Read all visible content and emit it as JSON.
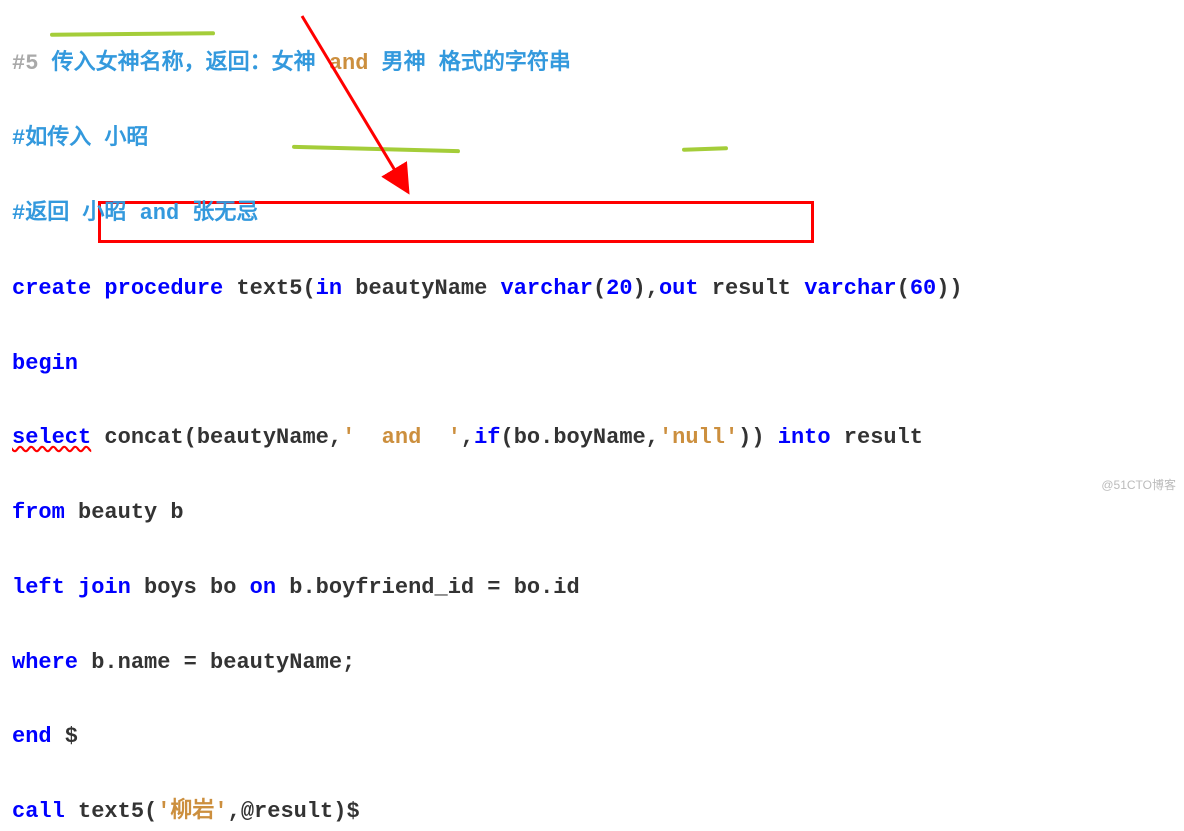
{
  "lines": {
    "l1_hash": "#5",
    "l1_part1": " 传入女神名称，返回：女神 ",
    "l1_and": "and",
    "l1_part2": " 男神 格式的字符串",
    "l2": "#如传入 小昭",
    "l3": "#返回 小昭 and 张无忌",
    "l4_create": "create",
    "l4_procedure": " procedure",
    "l4_text5": " text5",
    "l4_paren_open": "(",
    "l4_in": "in",
    "l4_beautyName": " beautyName ",
    "l4_varchar1": "varchar",
    "l4_p1a": "(",
    "l4_20": "20",
    "l4_p1b": "),",
    "l4_out": "out",
    "l4_result": " result ",
    "l4_varchar2": "varchar",
    "l4_p2a": "(",
    "l4_60": "60",
    "l4_p2b": "))",
    "l5_begin": "begin",
    "l6_select": "select",
    "l6_sp": " ",
    "l6_concat": "concat",
    "l6_po": "(",
    "l6_bn": "beautyName",
    "l6_comma": ",",
    "l6_str1": "'  and  '",
    "l6_comma2": ",",
    "l6_if": "if",
    "l6_po2": "(",
    "l6_boexpr": "bo.boyName,",
    "l6_str2": "'null'",
    "l6_pc": "))",
    "l6_sp2": " ",
    "l6_into": "into",
    "l6_result": " result",
    "l7_from": "from",
    "l7_rest": " beauty b",
    "l8_left": "left",
    "l8_join": " join",
    "l8_rest": " boys bo ",
    "l8_on": "on",
    "l8_rest2": " b.boyfriend_id = bo.id",
    "l9_where": "where",
    "l9_rest": " b.name = beautyName;",
    "l10_end": "end",
    "l10_rest": " $",
    "l11_call": "call",
    "l11_text5": " text5(",
    "l11_str": "'柳岩'",
    "l11_rest": ",@result)$"
  },
  "watermark": "@51CTO博客"
}
